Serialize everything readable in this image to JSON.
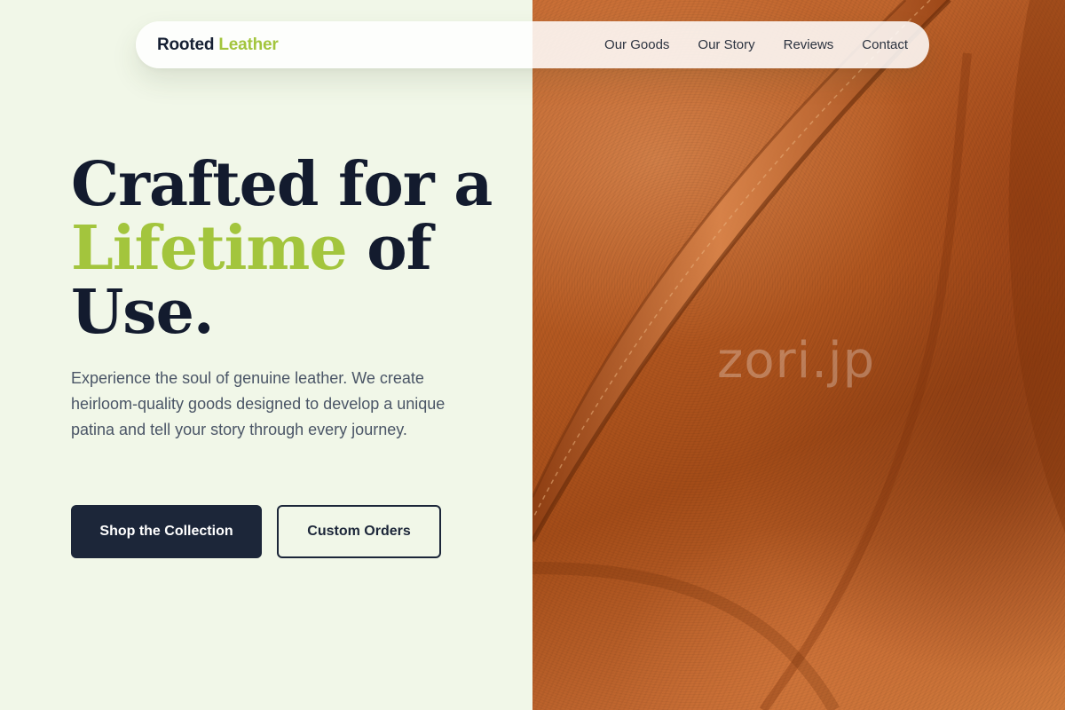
{
  "brand": {
    "name_part1": "Rooted",
    "name_part2": "Leather",
    "accent_color": "#a3c53d"
  },
  "nav": {
    "items": [
      {
        "label": "Our Goods"
      },
      {
        "label": "Our Story"
      },
      {
        "label": "Reviews"
      },
      {
        "label": "Contact"
      }
    ]
  },
  "hero": {
    "title_line1": "Crafted for a",
    "title_highlight": "Lifetime",
    "title_after_highlight": " of",
    "title_line3": "Use.",
    "description": "Experience the soul of genuine leather. We create heirloom-quality goods designed to develop a unique patina and tell your story through every journey.",
    "primary_button": "Shop the Collection",
    "secondary_button": "Custom Orders"
  },
  "image": {
    "alt": "leather bag close-up",
    "watermark": "zori.jp"
  },
  "colors": {
    "background": "#f1f7e8",
    "dark": "#1c2639",
    "accent": "#a3c53d",
    "leather": "#b65a22"
  }
}
